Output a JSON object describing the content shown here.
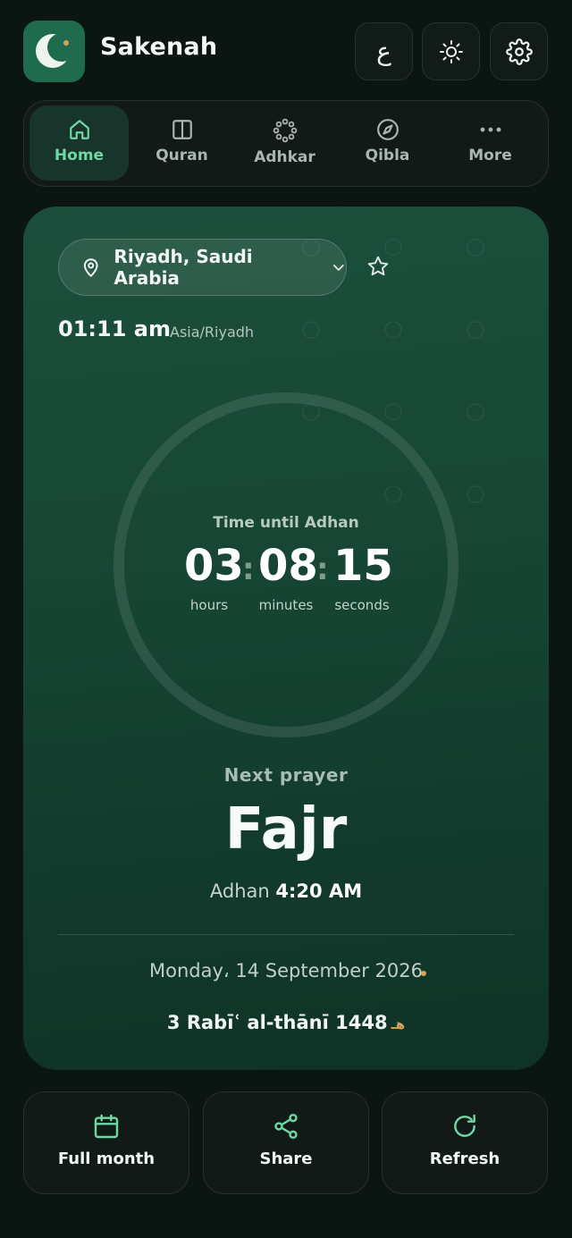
{
  "header": {
    "app_name": "Sakenah",
    "lang_label": "ع"
  },
  "nav": {
    "items": [
      {
        "label": "Home",
        "icon": "home-icon"
      },
      {
        "label": "Quran",
        "icon": "book-open-icon"
      },
      {
        "label": "Adhkar",
        "icon": "prayer-beads-icon"
      },
      {
        "label": "Qibla",
        "icon": "compass-icon"
      },
      {
        "label": "More",
        "icon": "more-dots-icon"
      }
    ],
    "active": "Home"
  },
  "location": {
    "city": "Riyadh, Saudi Arabia",
    "clock": "01:11 am",
    "timezone": "Asia/Riyadh"
  },
  "countdown": {
    "caption": "Time until Adhan",
    "hours": "03",
    "minutes": "08",
    "seconds": "15",
    "hours_label": "hours",
    "minutes_label": "minutes",
    "seconds_label": "seconds"
  },
  "next_prayer": {
    "caption": "Next prayer",
    "name": "Fajr",
    "adhan_prefix": "Adhan",
    "adhan_time": "4:20 AM"
  },
  "dates": {
    "gregorian": "Monday، 14 September 2026",
    "hijri": "3 Rabīʿ al-thānī 1448",
    "hijri_mark": "هـ"
  },
  "actions": [
    {
      "label": "Full month",
      "icon": "calendar-icon"
    },
    {
      "label": "Share",
      "icon": "share-icon"
    },
    {
      "label": "Refresh",
      "icon": "refresh-icon"
    }
  ],
  "colors": {
    "background": "#0b1512",
    "card": "#174634",
    "accent": "#6fd8a4",
    "gold": "#d9a15a"
  }
}
